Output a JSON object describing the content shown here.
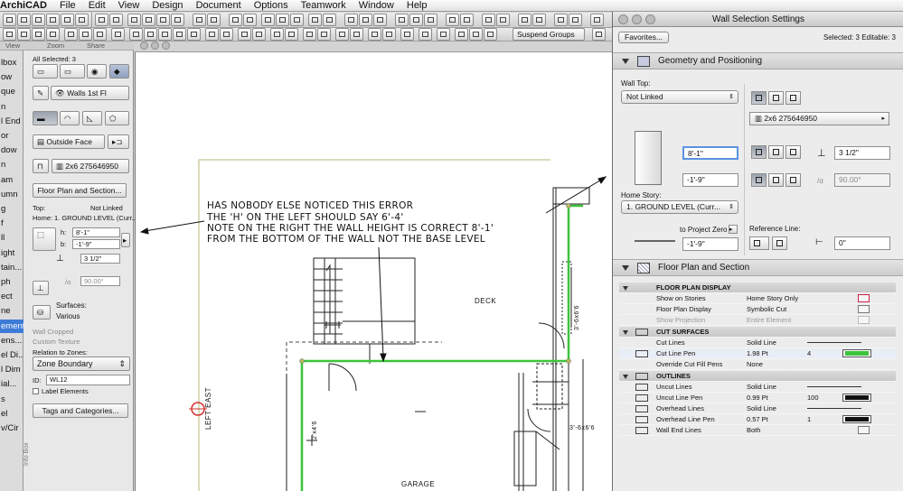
{
  "menubar": {
    "items": [
      "ArchiCAD",
      "File",
      "Edit",
      "View",
      "Design",
      "Document",
      "Options",
      "Teamwork",
      "Window",
      "Help"
    ]
  },
  "toolbar": {
    "suspend_groups": "Suspend Groups",
    "row2_tabs": [
      "View",
      "Zoom",
      "Share"
    ]
  },
  "toolbox": {
    "items": [
      "lbox",
      "ow",
      "que",
      "n",
      "l End",
      "or",
      "dow",
      "n",
      "am",
      "umn",
      "g",
      "f",
      "ll",
      "ight",
      "tain...",
      "ph",
      "ect",
      "ne",
      "ement",
      "ens...",
      "el Di...",
      "l Dim",
      "ial...",
      "s",
      "el",
      "v/Cir"
    ],
    "selected_index": 18
  },
  "infobox": {
    "all_selected": "All Selected: 3",
    "layer": "Walls 1st Fl",
    "reference_face": "Outside Face",
    "composite": "2x6 275646950",
    "floor_plan_button": "Floor Plan and Section...",
    "top_label": "Top:",
    "top_value": "Not Linked",
    "home_label": "Home:",
    "home_value": "1. GROUND LEVEL (Curr...",
    "h_label": "h:",
    "h_value": "8'-1\"",
    "b_label": "b:",
    "b_value": "-1'-9\"",
    "thickness": "3 1/2\"",
    "angle": "90.00°",
    "surfaces_label": "Surfaces:",
    "surfaces_value": "Various",
    "wall_cropped": "Wall Cropped",
    "custom_texture": "Custom Texture",
    "relation_label": "Relation to Zones:",
    "relation_value": "Zone Boundary",
    "id_label": "ID:",
    "id_value": "WL12",
    "label_elements": "Label Elements",
    "tags_button": "Tags and Categories...",
    "vertical_label": "Info Box"
  },
  "canvas": {
    "note_lines": [
      "HAS NOBODY ELSE NOTICED THIS ERROR",
      "THE 'H' ON THE LEFT SHOULD SAY 6'-4'",
      "NOTE ON THE RIGHT THE WALL HEIGHT IS CORRECT 8'-1'",
      "FROM THE BOTTOM OF THE WALL NOT THE BASE LEVEL"
    ],
    "deck_label": "DECK",
    "garage_label": "GARAGE",
    "left_label": "LEFT EAST",
    "window_label_1": "3'-6x6'6",
    "window_label_2": "3'-6x6'6",
    "window_label_3": "2'x4'6"
  },
  "panel": {
    "title": "Wall Selection Settings",
    "favorites": "Favorites...",
    "selected_info": "Selected: 3 Editable: 3",
    "geometry_section": "Geometry and Positioning",
    "wall_top_label": "Wall Top:",
    "wall_top_value": "Not Linked",
    "composite": "2x6 275646950",
    "height_value": "8'-1\"",
    "base_offset_value": "-1'-9\"",
    "thickness_value": "3 1/2\"",
    "angle_value": "90.00°",
    "home_story_label": "Home Story:",
    "home_story_value": "1. GROUND LEVEL (Curr...",
    "project_zero_label": "to Project Zero",
    "project_zero_value": "-1'-9\"",
    "reference_line_label": "Reference Line:",
    "reference_offset_value": "0\"",
    "floor_plan_section": "Floor Plan and Section"
  },
  "floor_plan_table": {
    "groups": [
      {
        "title": "FLOOR PLAN DISPLAY",
        "rows": [
          {
            "label": "Show on Stories",
            "value": "Home Story Only",
            "dim": false
          },
          {
            "label": "Floor Plan Display",
            "value": "Symbolic Cut",
            "dim": false
          },
          {
            "label": "Show Projection",
            "value": "Entire Element",
            "dim": true
          }
        ]
      },
      {
        "title": "CUT SURFACES",
        "rows": [
          {
            "label": "Cut Lines",
            "value": "Solid Line",
            "extra": ""
          },
          {
            "label": "Cut Line Pen",
            "value": "1.98 Pt",
            "extra": "4"
          },
          {
            "label": "Override Cut Fill Pens",
            "value": "None",
            "extra": ""
          }
        ]
      },
      {
        "title": "OUTLINES",
        "rows": [
          {
            "label": "Uncut Lines",
            "value": "Solid Line",
            "extra": ""
          },
          {
            "label": "Uncut Line Pen",
            "value": "0.99 Pt",
            "extra": "100"
          },
          {
            "label": "Overhead Lines",
            "value": "Solid Line",
            "extra": ""
          },
          {
            "label": "Overhead Line Pen",
            "value": "0.57 Pt",
            "extra": "1"
          },
          {
            "label": "Wall End Lines",
            "value": "Both",
            "extra": ""
          }
        ]
      }
    ]
  },
  "colors": {
    "selection_green": "#3cc43c",
    "accent_blue": "#3d7bd6",
    "wall_red": "#d23030"
  }
}
